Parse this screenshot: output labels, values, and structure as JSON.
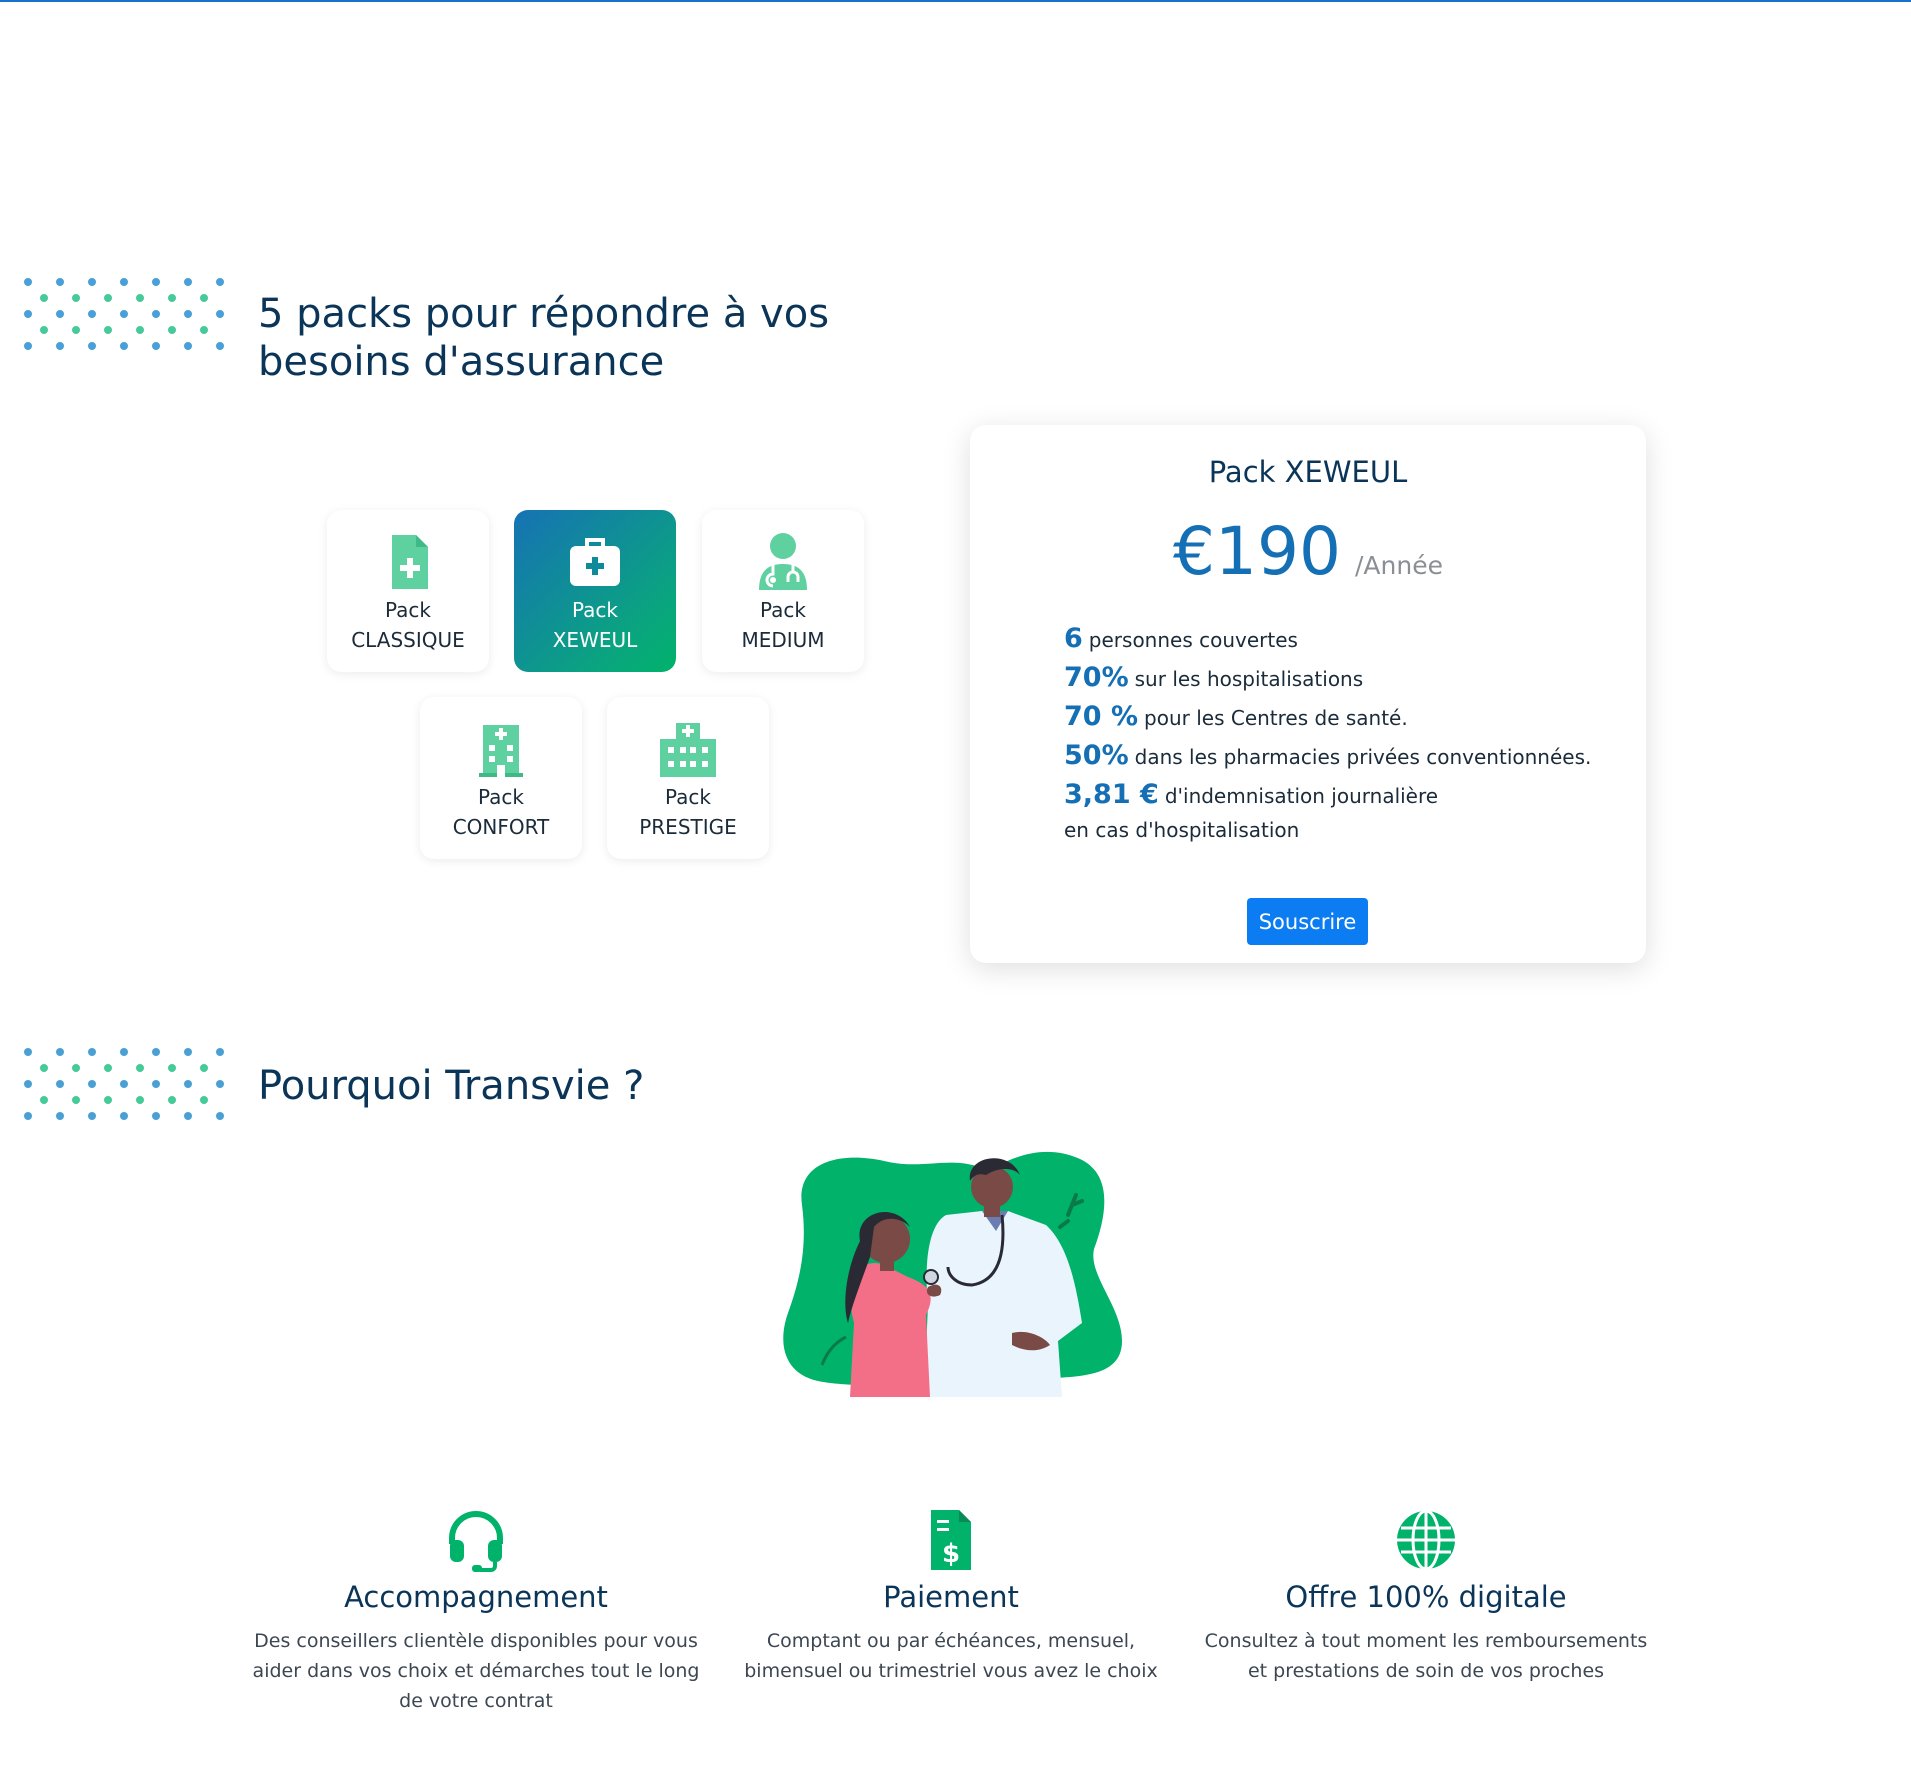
{
  "colors": {
    "accent_blue": "#146fb4",
    "accent_green": "#00b26a",
    "button_blue": "#0b7cf2",
    "heading": "#0b3558",
    "icon_green": "#5fd1a0"
  },
  "packs_section": {
    "title": "5 packs pour répondre à vos besoins d'assurance",
    "packs": [
      {
        "line1": "Pack",
        "line2": "CLASSIQUE",
        "icon": "medical-file-icon",
        "active": false
      },
      {
        "line1": "Pack",
        "line2": "XEWEUL",
        "icon": "medical-kit-icon",
        "active": true
      },
      {
        "line1": "Pack",
        "line2": "MEDIUM",
        "icon": "doctor-icon",
        "active": false
      },
      {
        "line1": "Pack",
        "line2": "CONFORT",
        "icon": "hospital-building-icon",
        "active": false
      },
      {
        "line1": "Pack",
        "line2": "PRESTIGE",
        "icon": "hospital-icon",
        "active": false
      }
    ]
  },
  "selected_pack": {
    "title": "Pack XEWEUL",
    "price": "€190",
    "period": "/Année",
    "features": [
      {
        "value": "6",
        "text": "personnes couvertes"
      },
      {
        "value": "70%",
        "text": "sur les hospitalisations"
      },
      {
        "value": "70 %",
        "text": "pour les Centres de santé."
      },
      {
        "value": "50%",
        "text": "dans les pharmacies privées conventionnées."
      },
      {
        "value": "3,81 €",
        "text": "d'indemnisation journalière"
      }
    ],
    "feature_note": "en cas d'hospitalisation",
    "button_label": "Souscrire"
  },
  "why_section": {
    "title": "Pourquoi Transvie ?",
    "illustration": "doctor-patient-illustration",
    "items": [
      {
        "icon": "headset-icon",
        "title": "Accompagnement",
        "text": "Des conseillers clientèle disponibles pour vous aider dans vos choix et démarches tout le long de votre contrat"
      },
      {
        "icon": "invoice-icon",
        "title": "Paiement",
        "text": "Comptant ou par échéances, mensuel, bimensuel ou trimestriel vous avez le choix"
      },
      {
        "icon": "globe-icon",
        "title": "Offre 100% digitale",
        "text": "Consultez à tout moment les remboursements et prestations de soin de vos proches"
      }
    ]
  }
}
